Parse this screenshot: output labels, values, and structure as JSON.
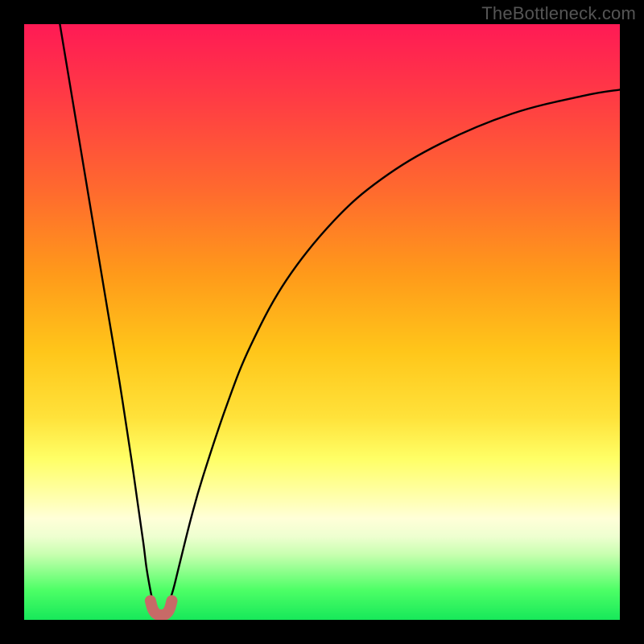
{
  "watermark": "TheBottleneck.com",
  "chart_data": {
    "type": "line",
    "title": "",
    "xlabel": "",
    "ylabel": "",
    "xlim": [
      0,
      100
    ],
    "ylim": [
      0,
      100
    ],
    "background_gradient_stops": [
      {
        "pct": 0,
        "color": "#ff1a55"
      },
      {
        "pct": 12,
        "color": "#ff3a45"
      },
      {
        "pct": 28,
        "color": "#ff6a2e"
      },
      {
        "pct": 42,
        "color": "#ff9a1a"
      },
      {
        "pct": 55,
        "color": "#ffc61a"
      },
      {
        "pct": 66,
        "color": "#ffe23a"
      },
      {
        "pct": 73,
        "color": "#ffff66"
      },
      {
        "pct": 79,
        "color": "#ffffa8"
      },
      {
        "pct": 83,
        "color": "#ffffd8"
      },
      {
        "pct": 86,
        "color": "#eeffd0"
      },
      {
        "pct": 89,
        "color": "#c8ffb0"
      },
      {
        "pct": 92,
        "color": "#8aff8a"
      },
      {
        "pct": 95,
        "color": "#4dff66"
      },
      {
        "pct": 100,
        "color": "#17e85a"
      }
    ],
    "series": [
      {
        "name": "left-branch",
        "color": "#000000",
        "x": [
          6,
          8,
          10,
          12,
          14,
          16,
          18,
          19,
          20,
          20.5,
          21,
          21.5,
          22
        ],
        "y": [
          100,
          88,
          76,
          64,
          52,
          40,
          27,
          20,
          13,
          9,
          6,
          3.5,
          2
        ]
      },
      {
        "name": "right-branch",
        "color": "#000000",
        "x": [
          24,
          25,
          26,
          28,
          30,
          34,
          38,
          44,
          52,
          60,
          70,
          82,
          94,
          100
        ],
        "y": [
          2,
          5,
          9,
          17,
          24,
          36,
          46,
          57,
          67,
          74,
          80,
          85,
          88,
          89
        ]
      },
      {
        "name": "valley-marker",
        "color": "#c76a67",
        "x": [
          21.2,
          21.6,
          22.2,
          23.0,
          23.8,
          24.4,
          24.8
        ],
        "y": [
          3.2,
          1.8,
          1.0,
          0.8,
          1.0,
          1.8,
          3.2
        ]
      }
    ],
    "optimum_x": 23
  }
}
